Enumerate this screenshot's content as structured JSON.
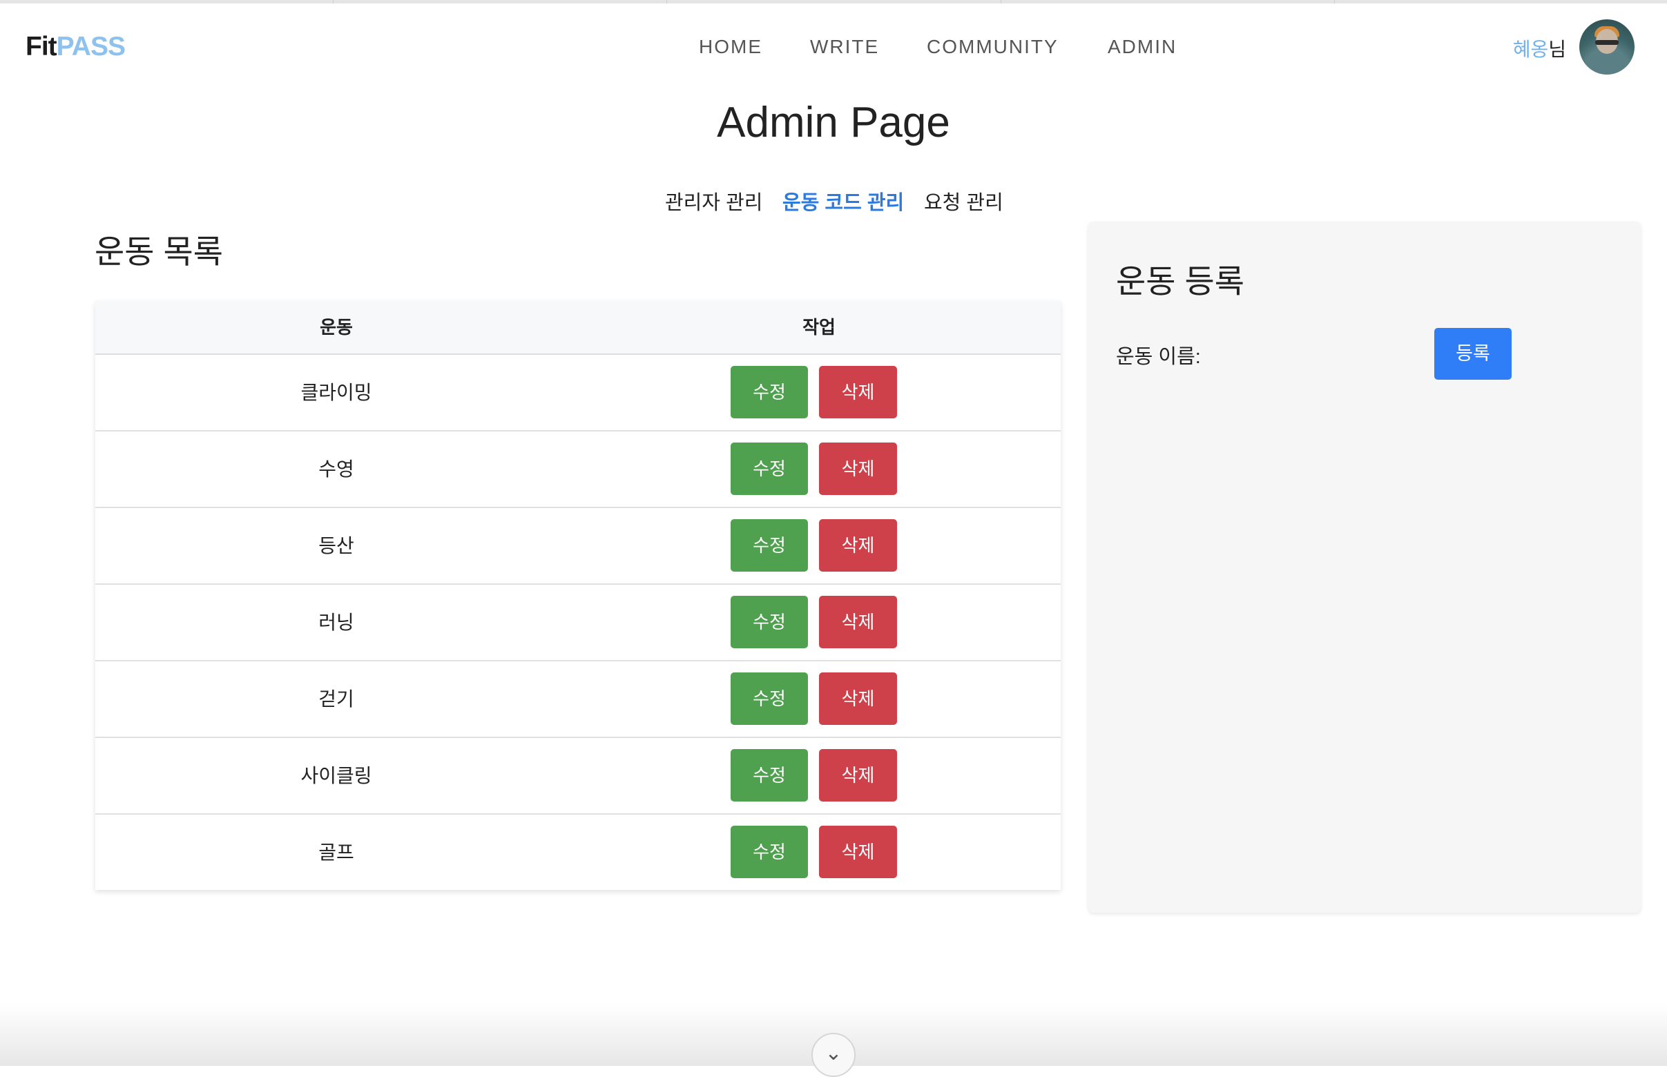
{
  "header": {
    "logo": {
      "part1": "Fit",
      "part2": "PASS"
    },
    "nav": [
      "HOME",
      "WRITE",
      "COMMUNITY",
      "ADMIN"
    ],
    "user": {
      "name": "혜옹",
      "suffix": "님"
    }
  },
  "page": {
    "title": "Admin Page",
    "tabs": [
      {
        "label": "관리자 관리",
        "active": false
      },
      {
        "label": "운동 코드 관리",
        "active": true
      },
      {
        "label": "요청 관리",
        "active": false
      }
    ]
  },
  "exercise_list": {
    "title": "운동 목록",
    "columns": [
      "운동",
      "작업"
    ],
    "rows": [
      {
        "name": "클라이밍",
        "edit": "수정",
        "delete": "삭제"
      },
      {
        "name": "수영",
        "edit": "수정",
        "delete": "삭제"
      },
      {
        "name": "등산",
        "edit": "수정",
        "delete": "삭제"
      },
      {
        "name": "러닝",
        "edit": "수정",
        "delete": "삭제"
      },
      {
        "name": "걷기",
        "edit": "수정",
        "delete": "삭제"
      },
      {
        "name": "사이클링",
        "edit": "수정",
        "delete": "삭제"
      },
      {
        "name": "골프",
        "edit": "수정",
        "delete": "삭제"
      }
    ]
  },
  "register_panel": {
    "title": "운동 등록",
    "label": "운동 이름:",
    "button": "등록"
  },
  "scroll_button": {
    "icon": "chevron-down-icon",
    "glyph": "⌄"
  },
  "colors": {
    "accent": "#2b7bdf",
    "edit": "#4fa14f",
    "delete": "#cf414a",
    "register": "#2f7ef7",
    "logo_pass": "#8ec2ee"
  }
}
